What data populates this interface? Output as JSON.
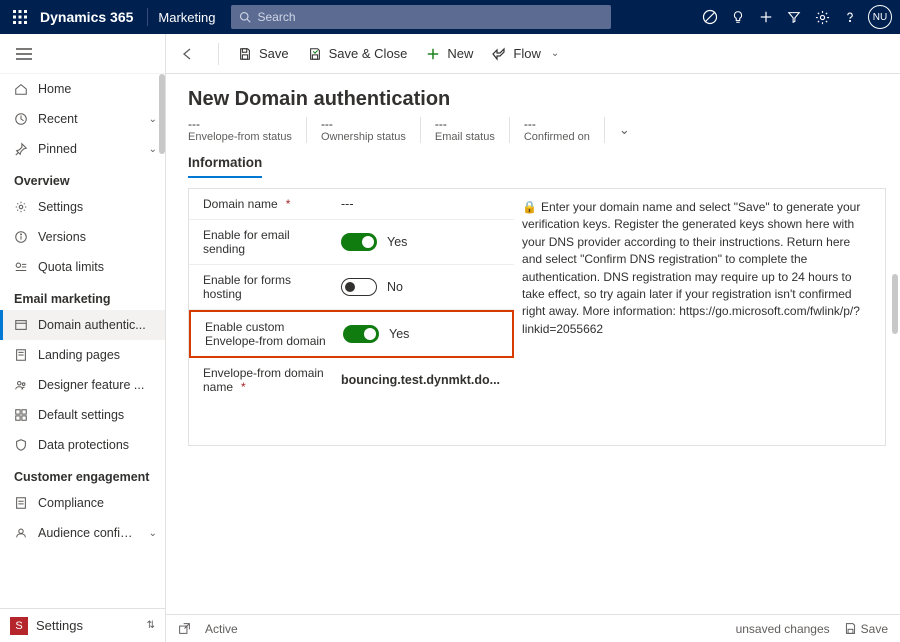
{
  "header": {
    "app": "Dynamics 365",
    "module": "Marketing",
    "search_placeholder": "Search",
    "avatar": "NU"
  },
  "sidebar": {
    "home": "Home",
    "recent": "Recent",
    "pinned": "Pinned",
    "section_overview": "Overview",
    "settings": "Settings",
    "versions": "Versions",
    "quota": "Quota limits",
    "section_email": "Email marketing",
    "domain_auth": "Domain authentic...",
    "landing": "Landing pages",
    "designer": "Designer feature ...",
    "default": "Default settings",
    "data_prot": "Data protections",
    "section_engagement": "Customer engagement",
    "compliance": "Compliance",
    "audience": "Audience configur...",
    "footer_badge": "S",
    "footer_label": "Settings"
  },
  "cmdbar": {
    "save": "Save",
    "save_close": "Save & Close",
    "new": "New",
    "flow": "Flow"
  },
  "page": {
    "title": "New Domain authentication",
    "status": {
      "env_from_val": "---",
      "env_from_lbl": "Envelope-from status",
      "ownership_val": "---",
      "ownership_lbl": "Ownership status",
      "email_val": "---",
      "email_lbl": "Email status",
      "confirmed_val": "---",
      "confirmed_lbl": "Confirmed on"
    },
    "tab": "Information",
    "form": {
      "domain_name_lbl": "Domain name",
      "domain_name_val": "---",
      "enable_email_lbl": "Enable for email sending",
      "enable_forms_lbl": "Enable for forms hosting",
      "enable_custom_lbl": "Enable custom Envelope-from domain",
      "envelope_domain_lbl": "Envelope-from domain name",
      "envelope_domain_val": "bouncing.test.dynmkt.do...",
      "yes": "Yes",
      "no": "No"
    },
    "help_text": "Enter your domain name and select \"Save\" to generate your verification keys. Register the generated keys shown here with your DNS provider according to their instructions. Return here and select \"Confirm DNS registration\" to complete the authentication. DNS registration may require up to 24 hours to take effect, so try again later if your registration isn't confirmed right away. More information: ",
    "help_link": "https://go.microsoft.com/fwlink/p/?linkid=2055662"
  },
  "footer": {
    "active": "Active",
    "unsaved": "unsaved changes",
    "save": "Save"
  }
}
